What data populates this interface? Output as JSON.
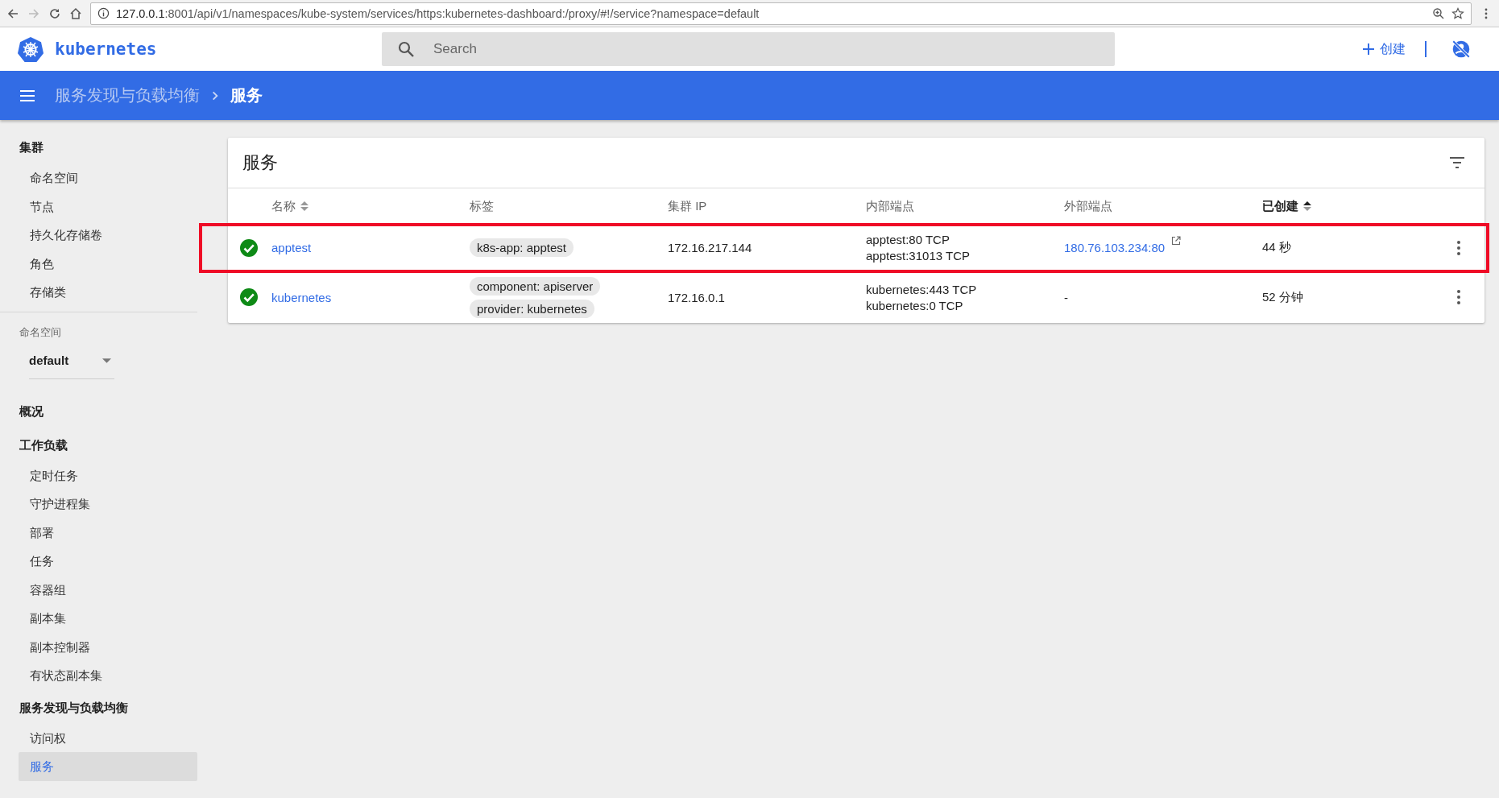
{
  "browser": {
    "url_host": "127.0.0.1",
    "url_rest": ":8001/api/v1/namespaces/kube-system/services/https:kubernetes-dashboard:/proxy/#!/service?namespace=default"
  },
  "header": {
    "brand": "kubernetes",
    "search": {
      "placeholder": "Search"
    },
    "create": "创建"
  },
  "breadcrumb": {
    "parent": "服务发现与负载均衡",
    "current": "服务"
  },
  "sidebar": [
    {
      "kind": "group",
      "title": "集群",
      "items": [
        {
          "label": "命名空间",
          "selected": false
        },
        {
          "label": "节点",
          "selected": false
        },
        {
          "label": "持久化存储卷",
          "selected": false
        },
        {
          "label": "角色",
          "selected": false
        },
        {
          "label": "存储类",
          "selected": false
        }
      ]
    },
    {
      "kind": "namespace",
      "label": "命名空间",
      "value": "default"
    },
    {
      "kind": "group",
      "title": "概况"
    },
    {
      "kind": "group",
      "title": "工作负载",
      "items": [
        {
          "label": "定时任务",
          "selected": false
        },
        {
          "label": "守护进程集",
          "selected": false
        },
        {
          "label": "部署",
          "selected": false
        },
        {
          "label": "任务",
          "selected": false
        },
        {
          "label": "容器组",
          "selected": false
        },
        {
          "label": "副本集",
          "selected": false
        },
        {
          "label": "副本控制器",
          "selected": false
        },
        {
          "label": "有状态副本集",
          "selected": false
        }
      ]
    },
    {
      "kind": "group",
      "title": "服务发现与负载均衡",
      "items": [
        {
          "label": "访问权",
          "selected": false
        },
        {
          "label": "服务",
          "selected": true
        }
      ]
    }
  ],
  "card": {
    "title": "服务",
    "columns": [
      {
        "label": "名称",
        "sortable": true,
        "sorted": false
      },
      {
        "label": "标签"
      },
      {
        "label": "集群 IP"
      },
      {
        "label": "内部端点"
      },
      {
        "label": "外部端点"
      },
      {
        "label": "已创建",
        "sortable": true,
        "sorted": true
      }
    ],
    "rows": [
      {
        "healthy": true,
        "name": "apptest",
        "labels": [
          "k8s-app: apptest"
        ],
        "cluster_ip": "172.16.217.144",
        "internal": [
          "apptest:80 TCP",
          "apptest:31013 TCP"
        ],
        "external": "180.76.103.234:80",
        "external_link": true,
        "created": "44 秒",
        "highlighted": true
      },
      {
        "healthy": true,
        "name": "kubernetes",
        "labels": [
          "component: apiserver",
          "provider: kubernetes"
        ],
        "cluster_ip": "172.16.0.1",
        "internal": [
          "kubernetes:443 TCP",
          "kubernetes:0 TCP"
        ],
        "external": "-",
        "external_link": false,
        "created": "52 分钟",
        "highlighted": false
      }
    ]
  }
}
